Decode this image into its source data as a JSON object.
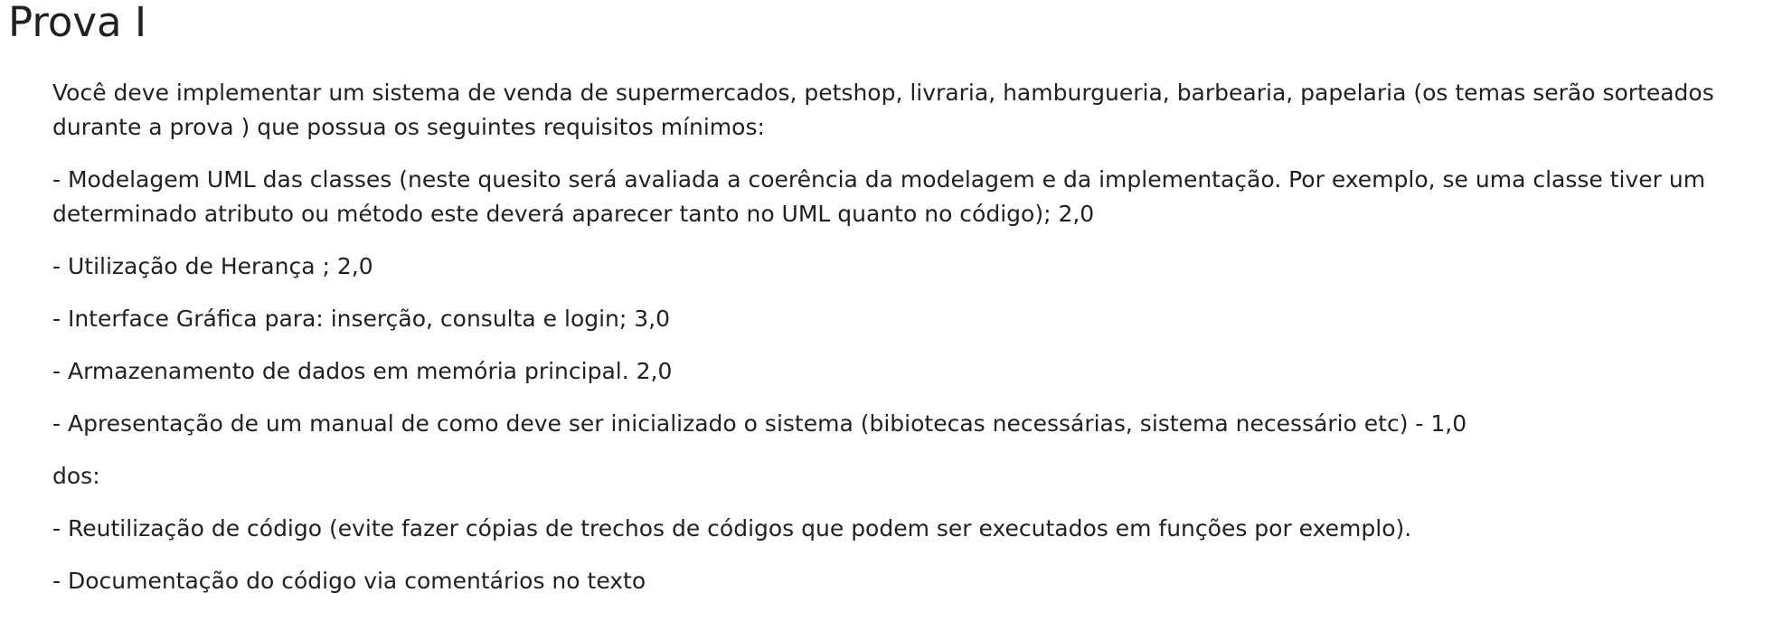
{
  "page": {
    "title": "Prova I"
  },
  "content": {
    "intro": "Você deve implementar um sistema de venda de supermercados, petshop, livraria, hamburgueria, barbearia, papelaria (os temas serão sorteados durante a prova ) que possua os seguintes requisitos mínimos:",
    "requirements": [
      "- Modelagem UML das classes (neste quesito será avaliada a coerência da modelagem e da implementação. Por exemplo, se uma classe tiver um determinado atributo ou método este deverá aparecer tanto no UML quanto no código); 2,0",
      "- Utilização de Herança ; 2,0",
      "- Interface Gráfica para: inserção, consulta  e login; 3,0",
      "- Armazenamento de dados em memória principal. 2,0",
      "- Apresentação de um manual de como deve ser inicializado o sistema (bibiotecas necessárias, sistema necessário etc) - 1,0"
    ],
    "extras_heading": "dos:",
    "extras": [
      "- Reutilização de código (evite fazer cópias de trechos de códigos que podem ser executados em funções por exemplo).",
      "- Documentação do código via comentários no texto"
    ]
  }
}
